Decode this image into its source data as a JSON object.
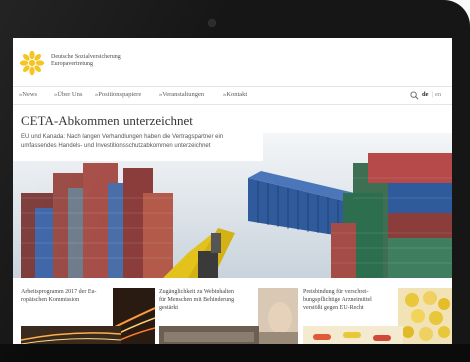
{
  "site": {
    "org_line1": "Deutsche Sozialversicherung",
    "org_line2": "Europavertretung"
  },
  "nav": {
    "items": [
      "»News",
      "»Über Uns",
      "»Positionspapiere",
      "»Veranstaltungen",
      "»Kontakt"
    ],
    "lang_de": "de",
    "lang_sep": "|",
    "lang_en": "en"
  },
  "article": {
    "title": "CETA-Abkommen unterzeichnet",
    "teaser_lines": [
      "EU und Kanada: Nach langen Verhandlungen haben die Vertragspartner ein",
      "umfassendes Handels- und Investitionsschutzabkommen unterzeichnet"
    ]
  },
  "cards": [
    {
      "lines": [
        "Arbeitsprogramm 2017 der Eu-",
        "ropäischen Kommission"
      ]
    },
    {
      "lines": [
        "Zugänglichkeit zu Webinhalten",
        "für Menschen mit Behinderung",
        "gestärkt"
      ]
    },
    {
      "lines": [
        "Preisbindung für verschrei-",
        "bungspflichtige Arzneimittel",
        "verstößt gegen EU-Recht"
      ]
    }
  ],
  "colors": {
    "logo_yellow": "#f6c21a",
    "nav_text": "#5a5a5a",
    "container_blue": "#2f5a9c",
    "crane_yellow": "#e2c21b"
  },
  "icons": {
    "logo": "star-logo-icon",
    "search": "magnifier-icon",
    "camera": "camera-icon"
  }
}
